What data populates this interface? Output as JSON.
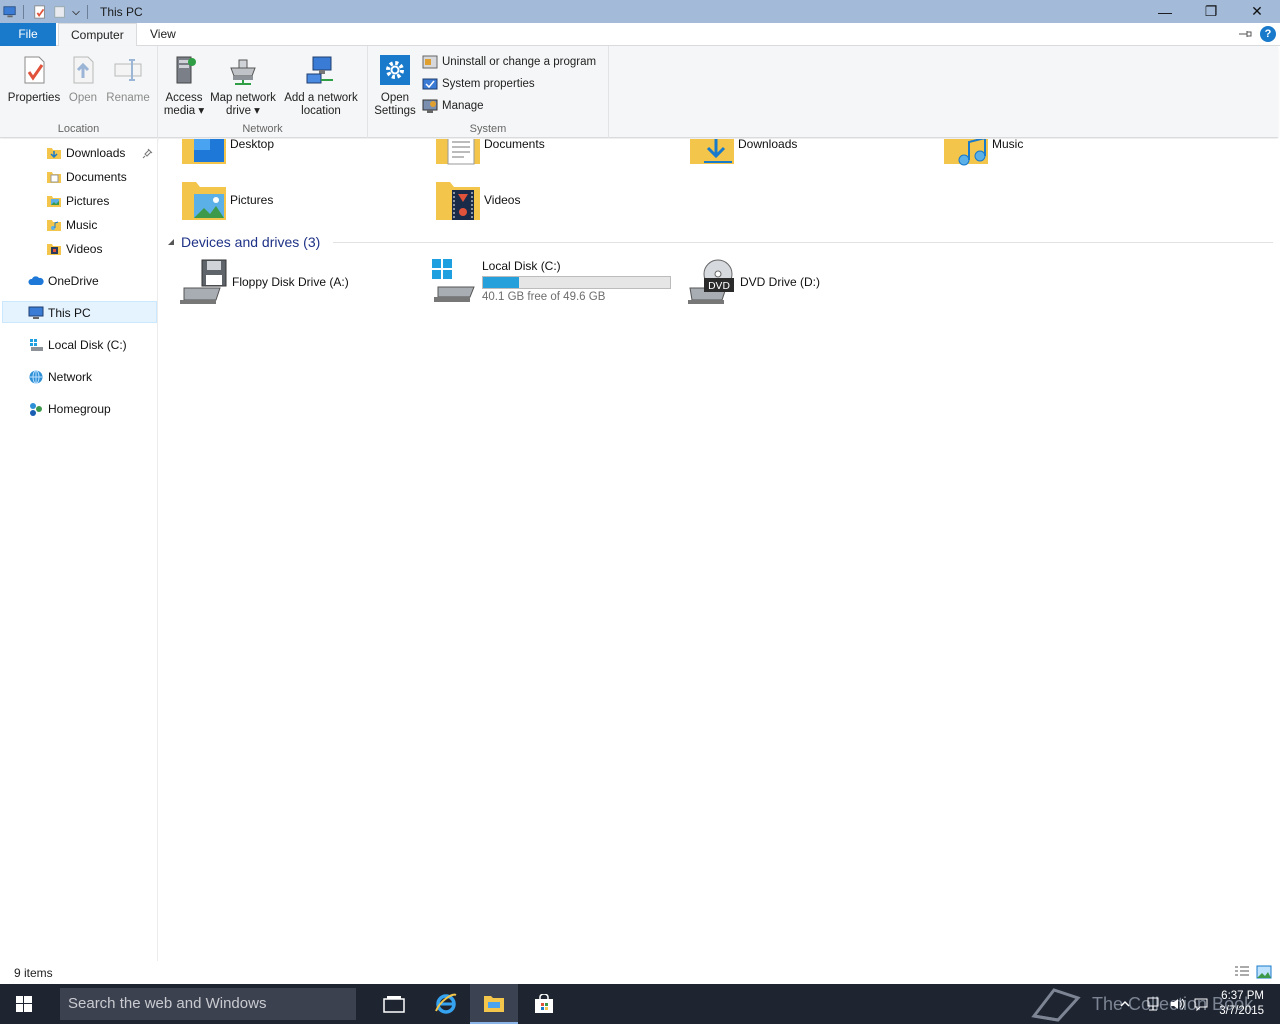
{
  "window": {
    "title": "This PC",
    "controls": {
      "minimize": "—",
      "restore": "❐",
      "close": "✕"
    }
  },
  "tabs": {
    "file": "File",
    "computer": "Computer",
    "view": "View"
  },
  "ribbon": {
    "location": {
      "label": "Location",
      "properties": "Properties",
      "open": "Open",
      "rename": "Rename"
    },
    "network": {
      "label": "Network",
      "access_media_1": "Access",
      "access_media_2": "media ▾",
      "map_drive_1": "Map network",
      "map_drive_2": "drive ▾",
      "add_location_1": "Add a network",
      "add_location_2": "location"
    },
    "system": {
      "label": "System",
      "open_settings_1": "Open",
      "open_settings_2": "Settings",
      "uninstall": "Uninstall or change a program",
      "system_properties": "System properties",
      "manage": "Manage"
    }
  },
  "nav": {
    "items": [
      {
        "label": "Downloads"
      },
      {
        "label": "Documents"
      },
      {
        "label": "Pictures"
      },
      {
        "label": "Music"
      },
      {
        "label": "Videos"
      },
      {
        "label": "OneDrive"
      },
      {
        "label": "This PC"
      },
      {
        "label": "Local Disk (C:)"
      },
      {
        "label": "Network"
      },
      {
        "label": "Homegroup"
      }
    ]
  },
  "folders": [
    {
      "label": "Desktop"
    },
    {
      "label": "Documents"
    },
    {
      "label": "Downloads"
    },
    {
      "label": "Music"
    },
    {
      "label": "Pictures"
    },
    {
      "label": "Videos"
    }
  ],
  "devices": {
    "header": "Devices and drives (3)",
    "floppy": {
      "label": "Floppy Disk Drive (A:)"
    },
    "local": {
      "label": "Local Disk (C:)",
      "free": "40.1 GB free of 49.6 GB",
      "used_fraction": 0.19
    },
    "dvd": {
      "label": "DVD Drive (D:)",
      "badge": "DVD"
    }
  },
  "status": {
    "count": "9 items"
  },
  "taskbar": {
    "search_placeholder": "Search the web and Windows",
    "time": "6:37 PM",
    "date": "3/7/2015",
    "watermark": "The Collection Book"
  },
  "colors": {
    "accent": "#1979ca",
    "drive_bar": "#26a0da",
    "title_bar": "#a3bbd9",
    "taskbar": "#1e2430"
  }
}
